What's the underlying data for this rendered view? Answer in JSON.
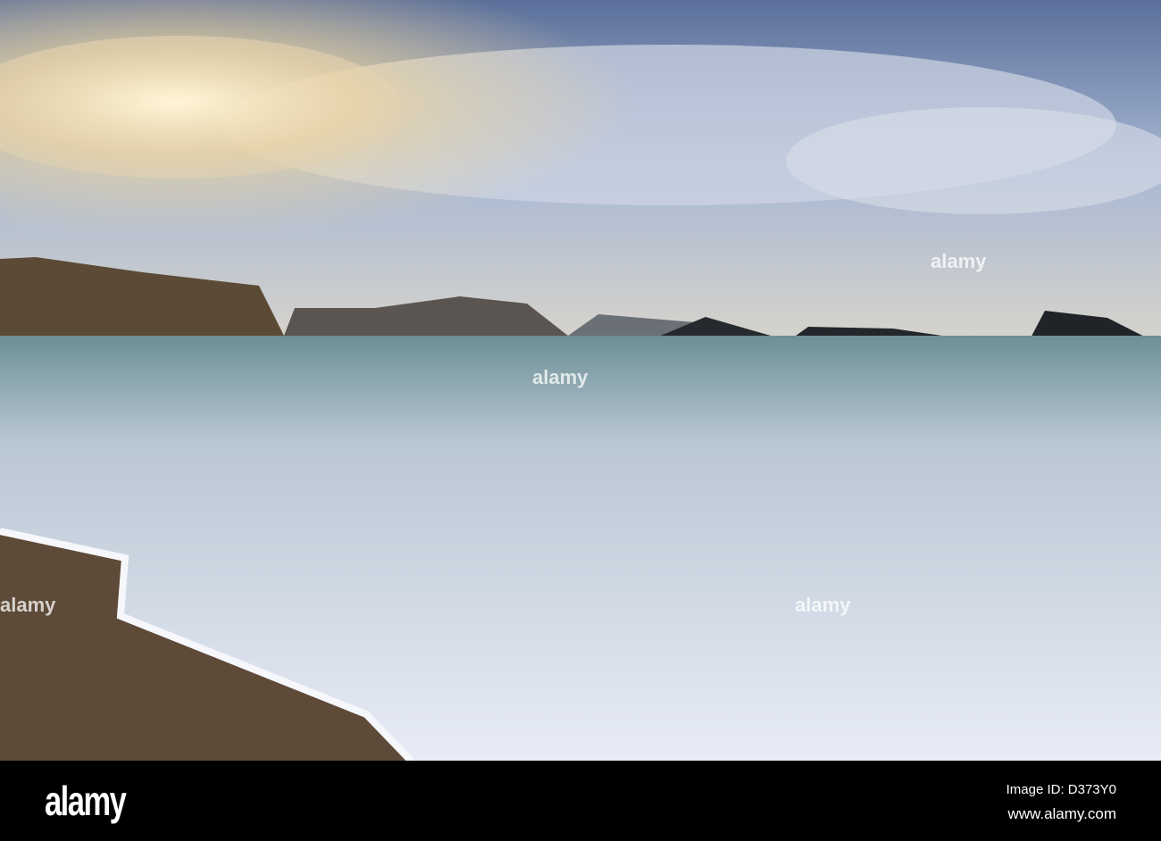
{
  "photo": {
    "description_colors": {
      "sky": "#7f9fd0",
      "sun": "#fff2c8",
      "sea": "#5f8a95",
      "foam": "#eef2fa",
      "sand": "#5e4a38"
    }
  },
  "watermark": "alamy",
  "footer": {
    "logo": "alamy",
    "image_id": "Image ID: D373Y0",
    "url": "www.alamy.com"
  }
}
